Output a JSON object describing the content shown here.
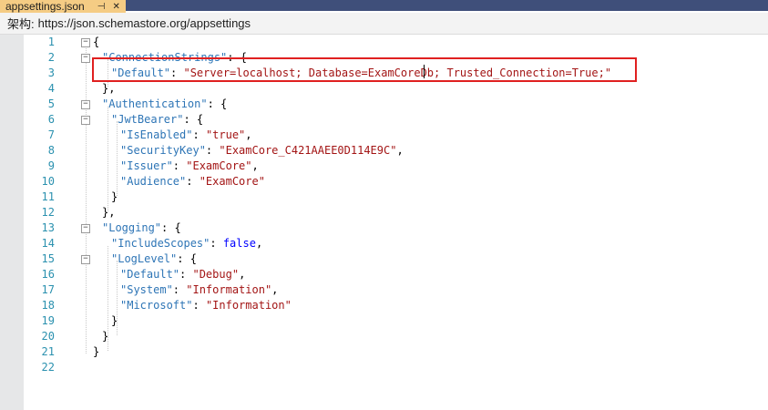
{
  "tab": {
    "title": "appsettings.json",
    "pin_icon": "pin-icon",
    "close_icon": "close-icon"
  },
  "schema": {
    "label": "架构:",
    "url": "https://json.schemastore.org/appsettings"
  },
  "lines": [
    {
      "n": "1",
      "tokens": [
        [
          "p",
          "{"
        ]
      ]
    },
    {
      "n": "2",
      "tokens": [
        [
          "k",
          "\"ConnectionStrings\""
        ],
        [
          "p",
          ": {"
        ]
      ]
    },
    {
      "n": "3",
      "tokens": [
        [
          "k",
          "\"Default\""
        ],
        [
          "p",
          ": "
        ],
        [
          "s",
          "\"Server=localhost; Database=ExamCoreDb; Trusted_Connection=True;\""
        ]
      ]
    },
    {
      "n": "4",
      "tokens": [
        [
          "p",
          "},"
        ]
      ]
    },
    {
      "n": "5",
      "tokens": [
        [
          "k",
          "\"Authentication\""
        ],
        [
          "p",
          ": {"
        ]
      ]
    },
    {
      "n": "6",
      "tokens": [
        [
          "k",
          "\"JwtBearer\""
        ],
        [
          "p",
          ": {"
        ]
      ]
    },
    {
      "n": "7",
      "tokens": [
        [
          "k",
          "\"IsEnabled\""
        ],
        [
          "p",
          ": "
        ],
        [
          "s",
          "\"true\""
        ],
        [
          "p",
          ","
        ]
      ]
    },
    {
      "n": "8",
      "tokens": [
        [
          "k",
          "\"SecurityKey\""
        ],
        [
          "p",
          ": "
        ],
        [
          "s",
          "\"ExamCore_C421AAEE0D114E9C\""
        ],
        [
          "p",
          ","
        ]
      ]
    },
    {
      "n": "9",
      "tokens": [
        [
          "k",
          "\"Issuer\""
        ],
        [
          "p",
          ": "
        ],
        [
          "s",
          "\"ExamCore\""
        ],
        [
          "p",
          ","
        ]
      ]
    },
    {
      "n": "10",
      "tokens": [
        [
          "k",
          "\"Audience\""
        ],
        [
          "p",
          ": "
        ],
        [
          "s",
          "\"ExamCore\""
        ]
      ]
    },
    {
      "n": "11",
      "tokens": [
        [
          "p",
          "}"
        ]
      ]
    },
    {
      "n": "12",
      "tokens": [
        [
          "p",
          "},"
        ]
      ]
    },
    {
      "n": "13",
      "tokens": [
        [
          "k",
          "\"Logging\""
        ],
        [
          "p",
          ": {"
        ]
      ]
    },
    {
      "n": "14",
      "tokens": [
        [
          "k",
          "\"IncludeScopes\""
        ],
        [
          "p",
          ": "
        ],
        [
          "kw",
          "false"
        ],
        [
          "p",
          ","
        ]
      ]
    },
    {
      "n": "15",
      "tokens": [
        [
          "k",
          "\"LogLevel\""
        ],
        [
          "p",
          ": {"
        ]
      ]
    },
    {
      "n": "16",
      "tokens": [
        [
          "k",
          "\"Default\""
        ],
        [
          "p",
          ": "
        ],
        [
          "s",
          "\"Debug\""
        ],
        [
          "p",
          ","
        ]
      ]
    },
    {
      "n": "17",
      "tokens": [
        [
          "k",
          "\"System\""
        ],
        [
          "p",
          ": "
        ],
        [
          "s",
          "\"Information\""
        ],
        [
          "p",
          ","
        ]
      ]
    },
    {
      "n": "18",
      "tokens": [
        [
          "k",
          "\"Microsoft\""
        ],
        [
          "p",
          ": "
        ],
        [
          "s",
          "\"Information\""
        ]
      ]
    },
    {
      "n": "19",
      "tokens": [
        [
          "p",
          "}"
        ]
      ]
    },
    {
      "n": "20",
      "tokens": [
        [
          "p",
          "}"
        ]
      ]
    },
    {
      "n": "21",
      "tokens": [
        [
          "p",
          "}"
        ]
      ]
    },
    {
      "n": "22",
      "tokens": []
    }
  ],
  "colors": {
    "key": "#2e75b6",
    "string": "#a31515",
    "keyword": "#0000ff",
    "line_number": "#2b91af",
    "highlight_border": "#e02020",
    "tab_bg": "#f5cc84",
    "titlebar_bg": "#3f4f7a"
  }
}
